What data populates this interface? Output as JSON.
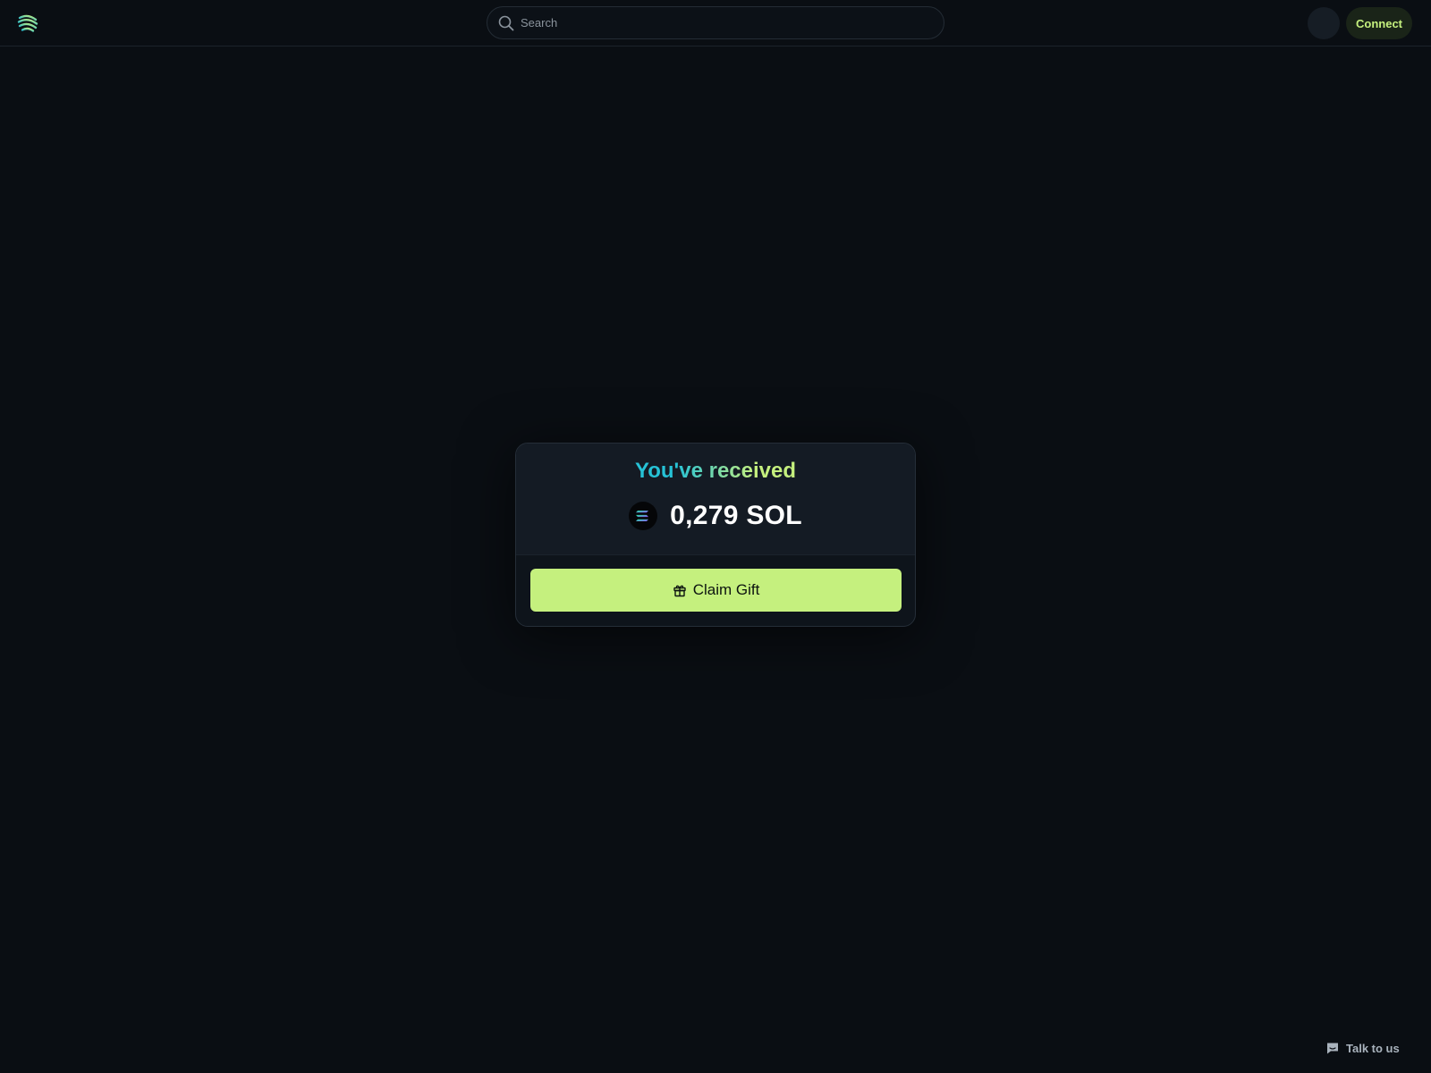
{
  "header": {
    "logo_icon": "striped-globe-logo-icon",
    "search": {
      "placeholder": "Search",
      "value": "",
      "icon": "search-icon"
    },
    "connect_label": "Connect"
  },
  "gift_card": {
    "title": "You've received",
    "token_icon": "solana-icon",
    "amount": "0,279 SOL",
    "claim_label": "Claim Gift",
    "claim_icon": "gift-icon"
  },
  "support": {
    "label": "Talk to us",
    "icon": "chat-icon"
  },
  "colors": {
    "background": "#0a0e13",
    "accent": "#c5f07e",
    "title_gradient_start": "#26c2d6",
    "title_gradient_end": "#c5f07e",
    "card_top": "#141b24"
  }
}
